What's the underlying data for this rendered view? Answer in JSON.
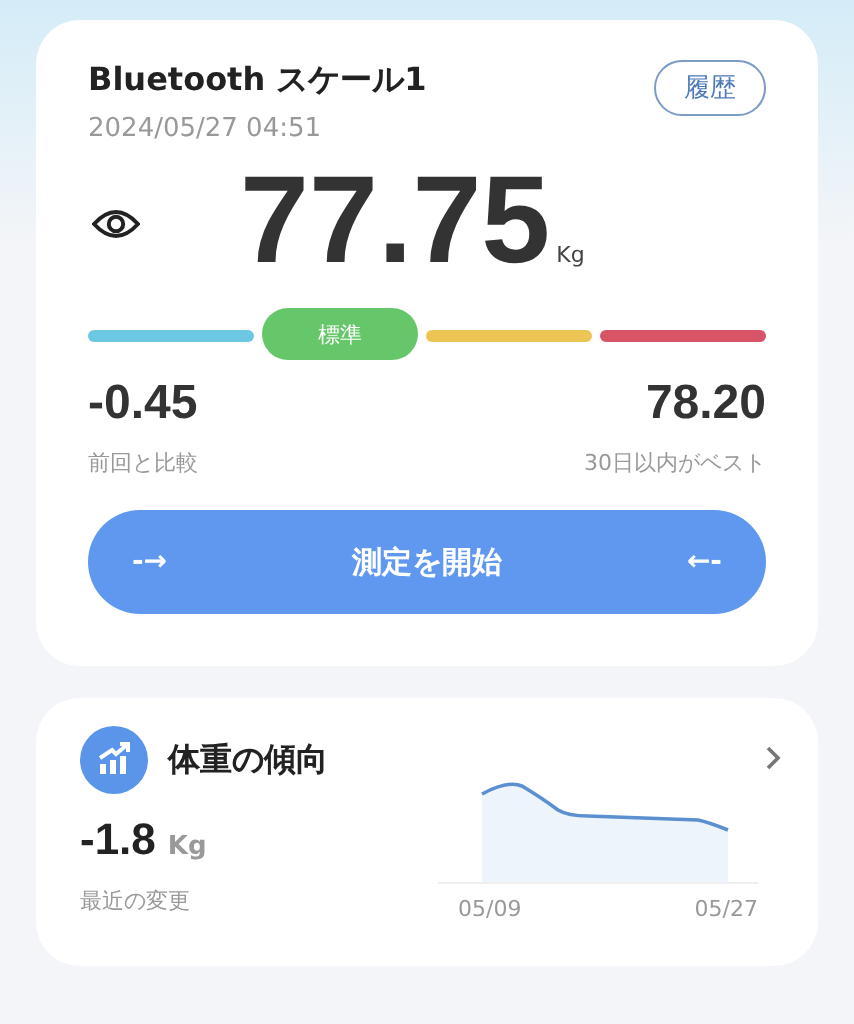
{
  "scale_card": {
    "title": "Bluetooth スケール1",
    "history_button": "履歴",
    "timestamp": "2024/05/27 04:51",
    "weight": "77.75",
    "unit": "Kg",
    "range": [
      {
        "color": "#6cc8e2",
        "selected": false
      },
      {
        "color": "#66c66a",
        "selected": true,
        "label": "標準"
      },
      {
        "color": "#ecc554",
        "selected": false
      },
      {
        "color": "#d95466",
        "selected": false
      }
    ],
    "stats": [
      {
        "value": "-0.45",
        "caption": "前回と比較"
      },
      {
        "value": "78.20",
        "caption": "30日以内がベスト"
      }
    ],
    "start_button": {
      "left_arrow": "-→",
      "label": "測定を開始",
      "right_arrow": "←-"
    }
  },
  "trend_card": {
    "title": "体重の傾向",
    "change": "-1.8",
    "unit": "Kg",
    "caption": "最近の変更",
    "x_labels": [
      "05/09",
      "05/27"
    ]
  }
}
